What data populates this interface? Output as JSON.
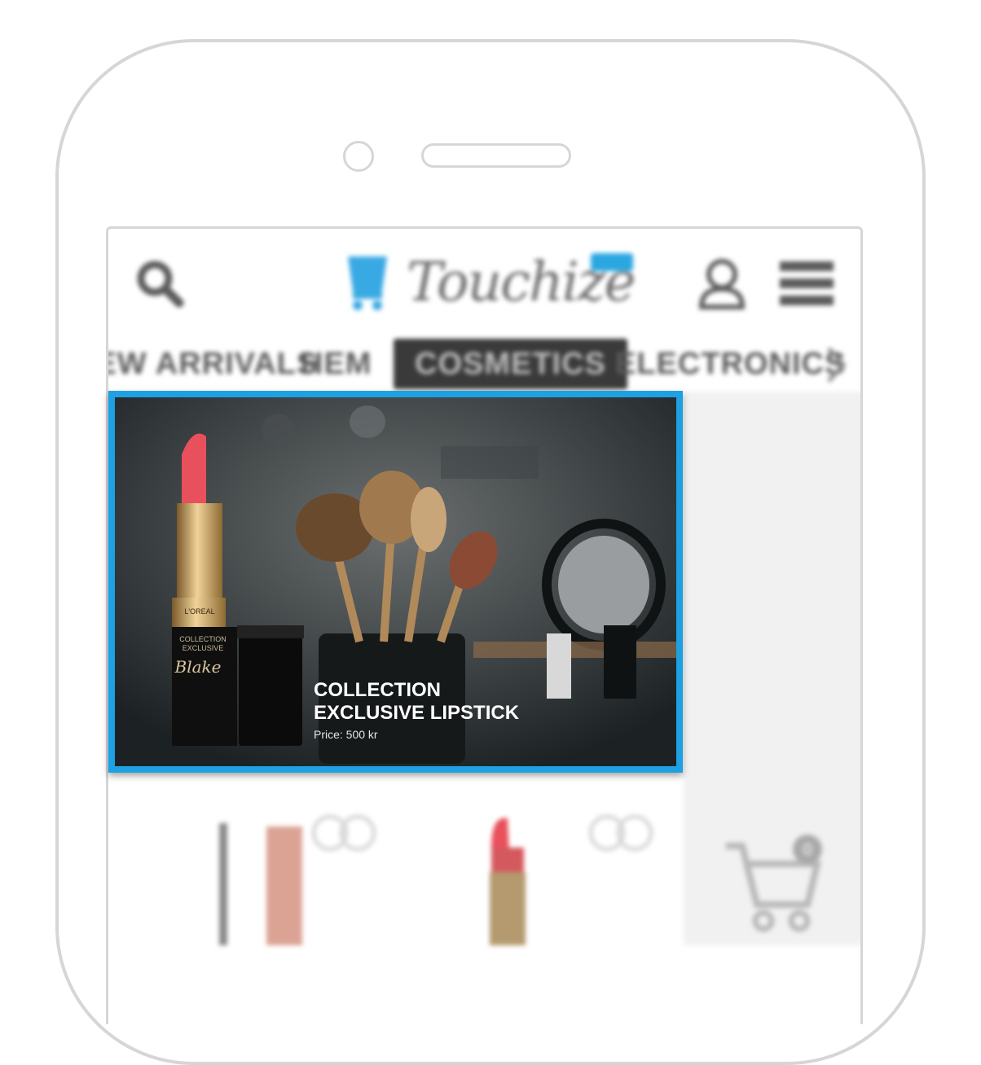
{
  "app": {
    "brand_name": "Touchize",
    "brand_badge": "",
    "colors": {
      "accent": "#1da1e2",
      "card_bg": "#1e2426",
      "lipstick": "#e8505b"
    }
  },
  "header": {
    "icons": [
      "search-icon",
      "user-icon",
      "menu-icon"
    ]
  },
  "tabs": [
    {
      "label": "NEW ARRIVALS",
      "active": false
    },
    {
      "label": "HEM",
      "active": false
    },
    {
      "label": "COSMETICS",
      "active": true
    },
    {
      "label": "ELECTRONICS",
      "active": false
    }
  ],
  "featured": {
    "title_line1": "COLLECTION",
    "title_line2": "EXCLUSIVE LIPSTICK",
    "price": "Price: 500 kr",
    "product_brand": "L'OREAL",
    "product_line1": "COLLECTION",
    "product_line2": "EXCLUSIVE",
    "product_script": "Blake"
  },
  "cart": {
    "count": "0"
  }
}
